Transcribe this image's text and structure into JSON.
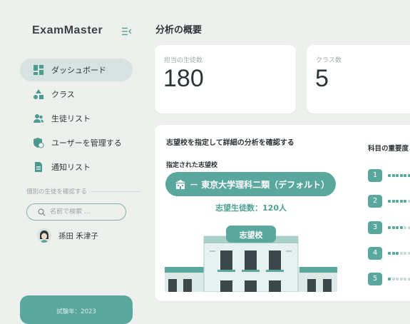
{
  "app": {
    "logo": "ExamMaster"
  },
  "sidebar": {
    "items": [
      {
        "label": "ダッシュボード",
        "icon": "dashboard-icon",
        "active": true
      },
      {
        "label": "クラス",
        "icon": "shapes-icon",
        "active": false
      },
      {
        "label": "生徒リスト",
        "icon": "users-icon",
        "active": false
      },
      {
        "label": "ユーザーを管理する",
        "icon": "shield-user-icon",
        "active": false
      },
      {
        "label": "通知リスト",
        "icon": "document-icon",
        "active": false
      }
    ],
    "section_label": "個別の生徒を確認する",
    "search_placeholder": "名前で検索 ...",
    "student_name": "孫田 禾津子",
    "year_label": "試験年：2023"
  },
  "main": {
    "title": "分析の概要",
    "stats": [
      {
        "label": "担当の生徒数",
        "value": "180"
      },
      {
        "label": "クラス数",
        "value": "5"
      }
    ],
    "panel": {
      "title": "志望校を指定して詳細の分析を確認する",
      "school_label": "指定された志望校",
      "school_button": "－ 東京大学理科二類（デフォルト）",
      "student_count": "志望生徒数：120人",
      "building_sign": "志望校"
    },
    "subject_title": "科目の重要度",
    "ranks": [
      {
        "rank": "1",
        "level": 6
      },
      {
        "rank": "2",
        "level": 5
      },
      {
        "rank": "3",
        "level": 4
      },
      {
        "rank": "4",
        "level": 3
      },
      {
        "rank": "5",
        "level": 1
      }
    ]
  },
  "colors": {
    "accent": "#5aa79e",
    "active_bg": "#d7e3e0",
    "background": "#eef0ee"
  }
}
